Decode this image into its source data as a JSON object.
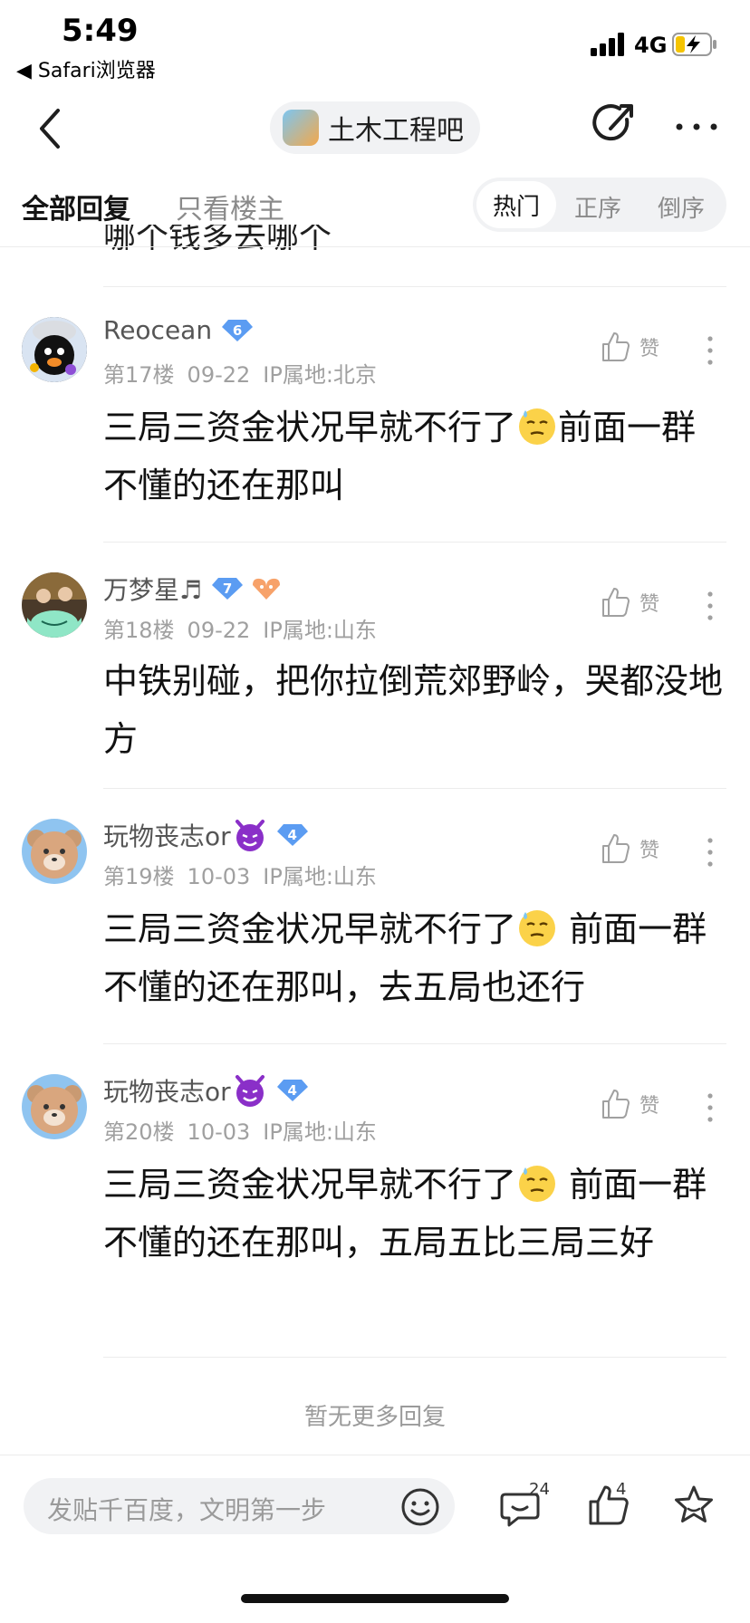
{
  "status_bar": {
    "time": "5:49",
    "back_app": "◀ Safari浏览器",
    "network": "4G"
  },
  "nav": {
    "forum_name": "土木工程吧"
  },
  "tabs": {
    "all_replies": "全部回复",
    "op_only": "只看楼主",
    "sort_hot": "热门",
    "sort_asc": "正序",
    "sort_desc": "倒序"
  },
  "clipped_text": "哪个钱多去哪个",
  "like_label": "赞",
  "posts": [
    {
      "username": "Reocean",
      "level": "6",
      "floor": "第17楼",
      "date": "09-22",
      "ip": "IP属地:北京",
      "content_a": "三局三资金状况早就不行了",
      "content_b": "前面一群不懂的还在那叫"
    },
    {
      "username": "万梦星♬",
      "level": "7",
      "floor": "第18楼",
      "date": "09-22",
      "ip": "IP属地:山东",
      "content": "中铁别碰，把你拉倒荒郊野岭，哭都没地方"
    },
    {
      "username": "玩物丧志or",
      "level": "4",
      "floor": "第19楼",
      "date": "10-03",
      "ip": "IP属地:山东",
      "content_a": "三局三资金状况早就不行了",
      "content_b": " 前面一群不懂的还在那叫，去五局也还行"
    },
    {
      "username": "玩物丧志or",
      "level": "4",
      "floor": "第20楼",
      "date": "10-03",
      "ip": "IP属地:山东",
      "content_a": "三局三资金状况早就不行了",
      "content_b": " 前面一群不懂的还在那叫，五局五比三局三好"
    }
  ],
  "no_more": "暂无更多回复",
  "bottom_bar": {
    "input_placeholder": "发贴千百度，文明第一步",
    "comment_count": "24",
    "like_count": "4"
  },
  "colors": {
    "level_badge": "#5b9cf2",
    "background": "#ffffff",
    "pill": "#f1f2f4"
  }
}
